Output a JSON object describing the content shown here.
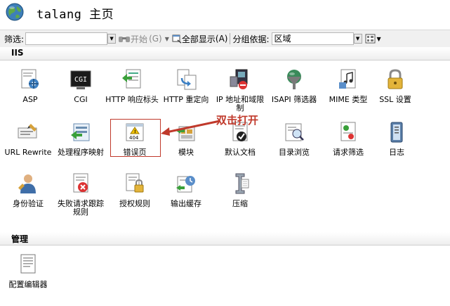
{
  "header": {
    "title": "talang 主页"
  },
  "toolbar": {
    "filter_label": "筛选:",
    "go_label": "开始",
    "go_shortcut": "(G)",
    "showall_label": "全部显示",
    "showall_shortcut": "(A)",
    "groupby_label": "分组依据:",
    "groupby_value": "区域"
  },
  "sections": {
    "iis": "IIS",
    "management": "管理"
  },
  "iis_items": [
    {
      "label": "ASP",
      "icon": "asp-icon"
    },
    {
      "label": "CGI",
      "icon": "cgi-icon"
    },
    {
      "label": "HTTP 响应标头",
      "icon": "http-response-headers-icon"
    },
    {
      "label": "HTTP 重定向",
      "icon": "http-redirect-icon"
    },
    {
      "label": "IP 地址和域限制",
      "icon": "ip-domain-restrictions-icon"
    },
    {
      "label": "ISAPI 筛选器",
      "icon": "isapi-filters-icon"
    },
    {
      "label": "MIME 类型",
      "icon": "mime-types-icon"
    },
    {
      "label": "SSL 设置",
      "icon": "ssl-lock-icon"
    },
    {
      "label": "URL Rewrite",
      "icon": "url-rewrite-icon"
    },
    {
      "label": "处理程序映射",
      "icon": "handler-mappings-icon"
    },
    {
      "label": "错误页",
      "icon": "error-pages-404-icon"
    },
    {
      "label": "模块",
      "icon": "modules-icon"
    },
    {
      "label": "默认文档",
      "icon": "default-document-icon"
    },
    {
      "label": "目录浏览",
      "icon": "directory-browsing-icon"
    },
    {
      "label": "请求筛选",
      "icon": "request-filtering-icon"
    },
    {
      "label": "日志",
      "icon": "logging-icon"
    },
    {
      "label": "身份验证",
      "icon": "authentication-icon"
    },
    {
      "label": "失败请求跟踪规则",
      "icon": "failed-request-tracing-icon"
    },
    {
      "label": "授权规则",
      "icon": "authorization-rules-icon"
    },
    {
      "label": "输出缓存",
      "icon": "output-caching-icon"
    },
    {
      "label": "压缩",
      "icon": "compression-icon"
    }
  ],
  "management_items": [
    {
      "label": "配置编辑器",
      "icon": "configuration-editor-icon"
    }
  ],
  "annotation": {
    "text": "双击打开",
    "color": "#c0392b"
  }
}
